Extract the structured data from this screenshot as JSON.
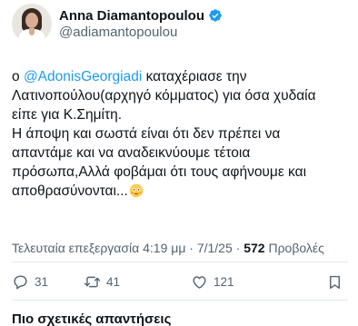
{
  "author": {
    "display_name": "Anna Diamantopoulou",
    "handle": "@adiamantopoulou"
  },
  "tweet": {
    "lines": [
      {
        "prefix": "ο ",
        "mention": "@AdonisGeorgiadi",
        "text": " καταχέριασε  την"
      },
      {
        "text": "Λατινοπούλου(αρχηγό κόμματος) για όσα χυδαία"
      },
      {
        "text": "είπε για   Κ.Σημίτη."
      },
      {
        "text": "Η άποψη και σωστά είναι ότι δεν πρέπει να"
      },
      {
        "text": "απαντάμε και να αναδεικνύουμε τέτοια"
      },
      {
        "text": "πρόσωπα,Αλλά φοβάμαι ότι τους αφήνουμε και"
      },
      {
        "text": "αποθρασύνονται..."
      }
    ],
    "end_emoji": "flushed-face-emoji"
  },
  "meta": {
    "edited_label": "Τελευταία επεξεργασία 4:19 μμ · 7/1/25 · ",
    "views_count": "572",
    "views_label": " Προβολές"
  },
  "actions": {
    "replies": "31",
    "reposts": "41",
    "likes": "121"
  },
  "related_label": "Πιο σχετικές απαντήσεις",
  "colors": {
    "accent": "#1d9bf0",
    "secondary_text": "#536471",
    "text": "#0f1419"
  },
  "icons": [
    "verified-badge-icon",
    "reply-icon",
    "repost-icon",
    "like-icon",
    "bookmark-icon"
  ]
}
